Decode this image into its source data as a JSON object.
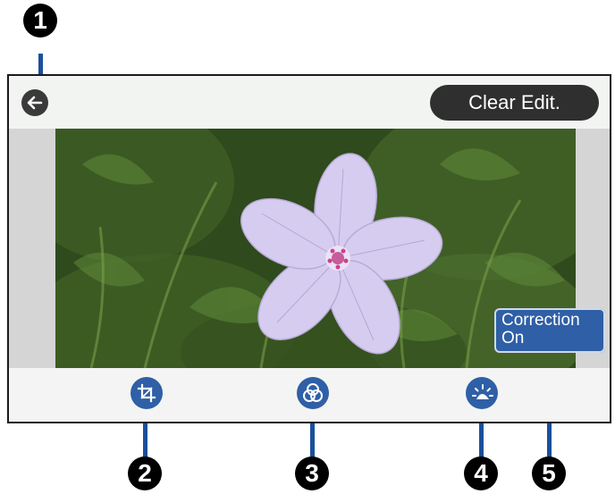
{
  "callouts": {
    "c1": "1",
    "c2": "2",
    "c3": "3",
    "c4": "4",
    "c5": "5"
  },
  "header": {
    "back_icon": "arrow-left-icon",
    "clear_edit_label": "Clear Edit."
  },
  "toolbar": {
    "crop_icon": "crop-icon",
    "filter_icon": "color-filter-icon",
    "brightness_icon": "brightness-icon"
  },
  "correction": {
    "line1": "Correction",
    "line2": "On"
  },
  "colors": {
    "accent_blue": "#2f5fa6",
    "dark_button": "#2f2f2f",
    "callout_black": "#000000",
    "leader_blue": "#1a4f9c"
  }
}
